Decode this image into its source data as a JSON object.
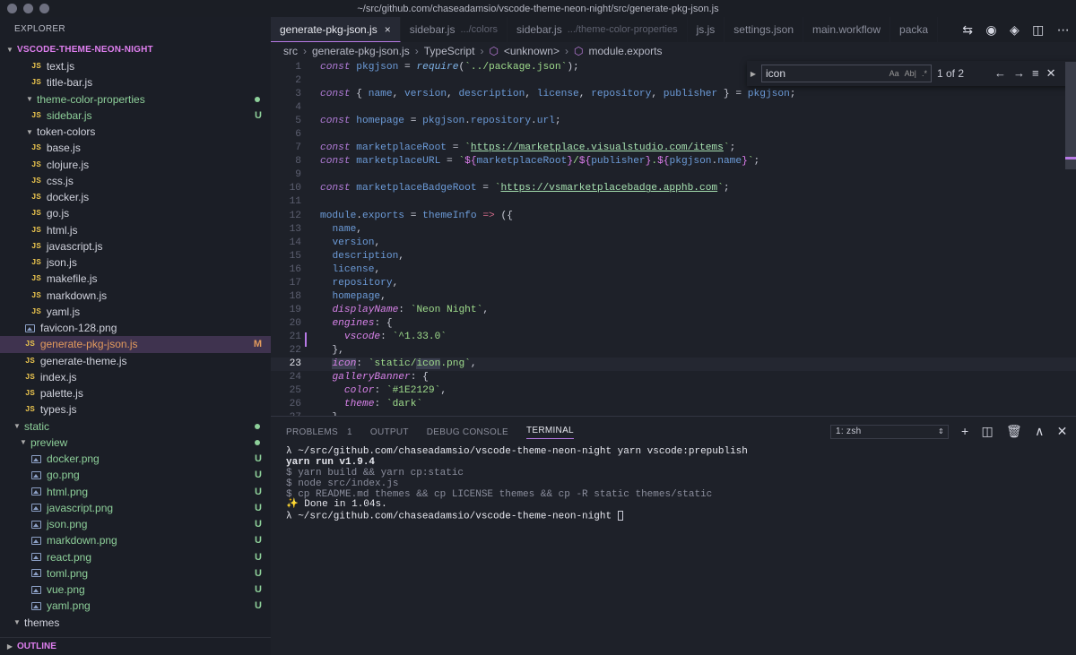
{
  "window": {
    "title": "~/src/github.com/chaseadamsio/vscode-theme-neon-night/src/generate-pkg-json.js"
  },
  "sidebar": {
    "header": "EXPLORER",
    "root": "VSCODE-THEME-NEON-NIGHT",
    "outline": "OUTLINE",
    "items": [
      {
        "label": "text.js",
        "type": "js",
        "indent": 1
      },
      {
        "label": "title-bar.js",
        "type": "js",
        "indent": 1
      },
      {
        "label": "theme-color-properties",
        "type": "folder",
        "indent": 1,
        "color": "green",
        "status": "dot"
      },
      {
        "label": "sidebar.js",
        "type": "js",
        "indent": 1,
        "color": "green",
        "status": "U"
      },
      {
        "label": "token-colors",
        "type": "folder",
        "indent": 1
      },
      {
        "label": "base.js",
        "type": "js",
        "indent": 1
      },
      {
        "label": "clojure.js",
        "type": "js",
        "indent": 1
      },
      {
        "label": "css.js",
        "type": "js",
        "indent": 1
      },
      {
        "label": "docker.js",
        "type": "js",
        "indent": 1
      },
      {
        "label": "go.js",
        "type": "js",
        "indent": 1
      },
      {
        "label": "html.js",
        "type": "js",
        "indent": 1
      },
      {
        "label": "javascript.js",
        "type": "js",
        "indent": 1
      },
      {
        "label": "json.js",
        "type": "js",
        "indent": 1
      },
      {
        "label": "makefile.js",
        "type": "js",
        "indent": 1
      },
      {
        "label": "markdown.js",
        "type": "js",
        "indent": 1
      },
      {
        "label": "yaml.js",
        "type": "js",
        "indent": 1
      },
      {
        "label": "favicon-128.png",
        "type": "img",
        "indent": 0
      },
      {
        "label": "generate-pkg-json.js",
        "type": "js",
        "indent": 0,
        "color": "orange",
        "status": "M",
        "selected": true
      },
      {
        "label": "generate-theme.js",
        "type": "js",
        "indent": 0
      },
      {
        "label": "index.js",
        "type": "js",
        "indent": 0
      },
      {
        "label": "palette.js",
        "type": "js",
        "indent": 0
      },
      {
        "label": "types.js",
        "type": "js",
        "indent": 0
      },
      {
        "label": "static",
        "type": "folder",
        "indent": -1,
        "color": "green",
        "status": "dot"
      },
      {
        "label": "preview",
        "type": "folder",
        "indent": 0,
        "color": "green",
        "status": "dot"
      },
      {
        "label": "docker.png",
        "type": "img",
        "indent": 1,
        "color": "green",
        "status": "U"
      },
      {
        "label": "go.png",
        "type": "img",
        "indent": 1,
        "color": "green",
        "status": "U"
      },
      {
        "label": "html.png",
        "type": "img",
        "indent": 1,
        "color": "green",
        "status": "U"
      },
      {
        "label": "javascript.png",
        "type": "img",
        "indent": 1,
        "color": "green",
        "status": "U"
      },
      {
        "label": "json.png",
        "type": "img",
        "indent": 1,
        "color": "green",
        "status": "U"
      },
      {
        "label": "markdown.png",
        "type": "img",
        "indent": 1,
        "color": "green",
        "status": "U"
      },
      {
        "label": "react.png",
        "type": "img",
        "indent": 1,
        "color": "green",
        "status": "U"
      },
      {
        "label": "toml.png",
        "type": "img",
        "indent": 1,
        "color": "green",
        "status": "U"
      },
      {
        "label": "vue.png",
        "type": "img",
        "indent": 1,
        "color": "green",
        "status": "U"
      },
      {
        "label": "yaml.png",
        "type": "img",
        "indent": 1,
        "color": "green",
        "status": "U"
      },
      {
        "label": "themes",
        "type": "folder",
        "indent": -1
      }
    ]
  },
  "tabs": [
    {
      "label": "generate-pkg-json.js",
      "desc": "",
      "active": true,
      "close": "×"
    },
    {
      "label": "sidebar.js",
      "desc": ".../colors"
    },
    {
      "label": "sidebar.js",
      "desc": ".../theme-color-properties"
    },
    {
      "label": "js.js",
      "desc": ""
    },
    {
      "label": "settings.json",
      "desc": ""
    },
    {
      "label": "main.workflow",
      "desc": ""
    },
    {
      "label": "packa",
      "desc": ""
    }
  ],
  "breadcrumbs": [
    "src",
    "generate-pkg-json.js",
    "TypeScript",
    "<unknown>",
    "module.exports"
  ],
  "find": {
    "query": "icon",
    "count": "1 of 2",
    "opt_case": "Aa",
    "opt_word": "Ab|",
    "opt_regex": ".*"
  },
  "code": {
    "current_line": 23,
    "lines": [
      [
        [
          "k",
          "const "
        ],
        [
          "v",
          "pkgjson"
        ],
        [
          "t",
          " = "
        ],
        [
          "f",
          "require"
        ],
        [
          "t",
          "("
        ],
        [
          "s",
          "`../package.json`"
        ],
        [
          "t",
          ");"
        ]
      ],
      [],
      [
        [
          "k",
          "const "
        ],
        [
          "t",
          "{ "
        ],
        [
          "v",
          "name"
        ],
        [
          "t",
          ", "
        ],
        [
          "v",
          "version"
        ],
        [
          "t",
          ", "
        ],
        [
          "v",
          "description"
        ],
        [
          "t",
          ", "
        ],
        [
          "v",
          "license"
        ],
        [
          "t",
          ", "
        ],
        [
          "v",
          "repository"
        ],
        [
          "t",
          ", "
        ],
        [
          "v",
          "publisher"
        ],
        [
          "t",
          " } = "
        ],
        [
          "v",
          "pkgjson"
        ],
        [
          "t",
          ";"
        ]
      ],
      [],
      [
        [
          "k",
          "const "
        ],
        [
          "v",
          "homepage"
        ],
        [
          "t",
          " = "
        ],
        [
          "v",
          "pkgjson"
        ],
        [
          "t",
          "."
        ],
        [
          "v",
          "repository"
        ],
        [
          "t",
          "."
        ],
        [
          "v",
          "url"
        ],
        [
          "t",
          ";"
        ]
      ],
      [],
      [
        [
          "k",
          "const "
        ],
        [
          "v",
          "marketplaceRoot"
        ],
        [
          "t",
          " = "
        ],
        [
          "s",
          "`"
        ],
        [
          "u",
          "https://marketplace.visualstudio.com/items"
        ],
        [
          "s",
          "`"
        ],
        [
          "t",
          ";"
        ]
      ],
      [
        [
          "k",
          "const "
        ],
        [
          "v",
          "marketplaceURL"
        ],
        [
          "t",
          " = "
        ],
        [
          "s",
          "`"
        ],
        [
          "ip",
          "${"
        ],
        [
          "v",
          "marketplaceRoot"
        ],
        [
          "ip",
          "}"
        ],
        [
          "s",
          "/"
        ],
        [
          "ip",
          "${"
        ],
        [
          "v",
          "publisher"
        ],
        [
          "ip",
          "}"
        ],
        [
          "s",
          "."
        ],
        [
          "ip",
          "${"
        ],
        [
          "v",
          "pkgjson"
        ],
        [
          "t",
          "."
        ],
        [
          "v",
          "name"
        ],
        [
          "ip",
          "}"
        ],
        [
          "s",
          "`"
        ],
        [
          "t",
          ";"
        ]
      ],
      [],
      [
        [
          "k",
          "const "
        ],
        [
          "v",
          "marketplaceBadgeRoot"
        ],
        [
          "t",
          " = "
        ],
        [
          "s",
          "`"
        ],
        [
          "u",
          "https://vsmarketplacebadge.apphb.com"
        ],
        [
          "s",
          "`"
        ],
        [
          "t",
          ";"
        ]
      ],
      [],
      [
        [
          "v",
          "module"
        ],
        [
          "t",
          "."
        ],
        [
          "v",
          "exports"
        ],
        [
          "t",
          " = "
        ],
        [
          "v",
          "themeInfo"
        ],
        [
          "t",
          " "
        ],
        [
          "o",
          "=>"
        ],
        [
          "t",
          " ({"
        ]
      ],
      [
        [
          "t",
          "  "
        ],
        [
          "v",
          "name"
        ],
        [
          "t",
          ","
        ]
      ],
      [
        [
          "t",
          "  "
        ],
        [
          "v",
          "version"
        ],
        [
          "t",
          ","
        ]
      ],
      [
        [
          "t",
          "  "
        ],
        [
          "v",
          "description"
        ],
        [
          "t",
          ","
        ]
      ],
      [
        [
          "t",
          "  "
        ],
        [
          "v",
          "license"
        ],
        [
          "t",
          ","
        ]
      ],
      [
        [
          "t",
          "  "
        ],
        [
          "v",
          "repository"
        ],
        [
          "t",
          ","
        ]
      ],
      [
        [
          "t",
          "  "
        ],
        [
          "v",
          "homepage"
        ],
        [
          "t",
          ","
        ]
      ],
      [
        [
          "t",
          "  "
        ],
        [
          "p",
          "displayName"
        ],
        [
          "t",
          ": "
        ],
        [
          "s",
          "`Neon Night`"
        ],
        [
          "t",
          ","
        ]
      ],
      [
        [
          "t",
          "  "
        ],
        [
          "p",
          "engines"
        ],
        [
          "t",
          ": {"
        ]
      ],
      [
        [
          "t",
          "    "
        ],
        [
          "p",
          "vscode"
        ],
        [
          "t",
          ": "
        ],
        [
          "s",
          "`^1.33.0`"
        ]
      ],
      [
        [
          "t",
          "  },"
        ]
      ],
      [
        [
          "t",
          "  "
        ],
        [
          "hp",
          "icon"
        ],
        [
          "t",
          ": "
        ],
        [
          "s",
          "`static/"
        ],
        [
          "hs",
          "icon"
        ],
        [
          "s",
          ".png`"
        ],
        [
          "t",
          ","
        ]
      ],
      [
        [
          "t",
          "  "
        ],
        [
          "p",
          "galleryBanner"
        ],
        [
          "t",
          ": {"
        ]
      ],
      [
        [
          "t",
          "    "
        ],
        [
          "p",
          "color"
        ],
        [
          "t",
          ": "
        ],
        [
          "s",
          "`#1E2129`"
        ],
        [
          "t",
          ","
        ]
      ],
      [
        [
          "t",
          "    "
        ],
        [
          "p",
          "theme"
        ],
        [
          "t",
          ": "
        ],
        [
          "s",
          "`dark`"
        ]
      ],
      [
        [
          "t",
          "  }"
        ]
      ]
    ]
  },
  "panel": {
    "tabs": [
      {
        "label": "PROBLEMS",
        "count": "1"
      },
      {
        "label": "OUTPUT"
      },
      {
        "label": "DEBUG CONSOLE"
      },
      {
        "label": "TERMINAL",
        "active": true
      }
    ],
    "terminal_select": "1: zsh",
    "terminal_lines": [
      {
        "text": "λ ~/src/github.com/chaseadamsio/vscode-theme-neon-night yarn vscode:prepublish",
        "style": "normal"
      },
      {
        "text": "yarn run v1.9.4",
        "style": "bold"
      },
      {
        "text": "$ yarn build && yarn cp:static",
        "style": "dim"
      },
      {
        "text": "$ node src/index.js",
        "style": "dim"
      },
      {
        "text": "$ cp README.md themes && cp LICENSE themes && cp -R static themes/static",
        "style": "dim"
      },
      {
        "text": "✨ Done in 1.04s.",
        "style": "normal"
      },
      {
        "text": "λ ~/src/github.com/chaseadamsio/vscode-theme-neon-night ",
        "style": "normal",
        "cursor": true
      }
    ]
  },
  "colors": {
    "accent": "#b87ae6",
    "folder_root": "#e07ff0",
    "untracked": "#8ed09a",
    "modified": "#e29a5d",
    "background": "#1e2129"
  }
}
